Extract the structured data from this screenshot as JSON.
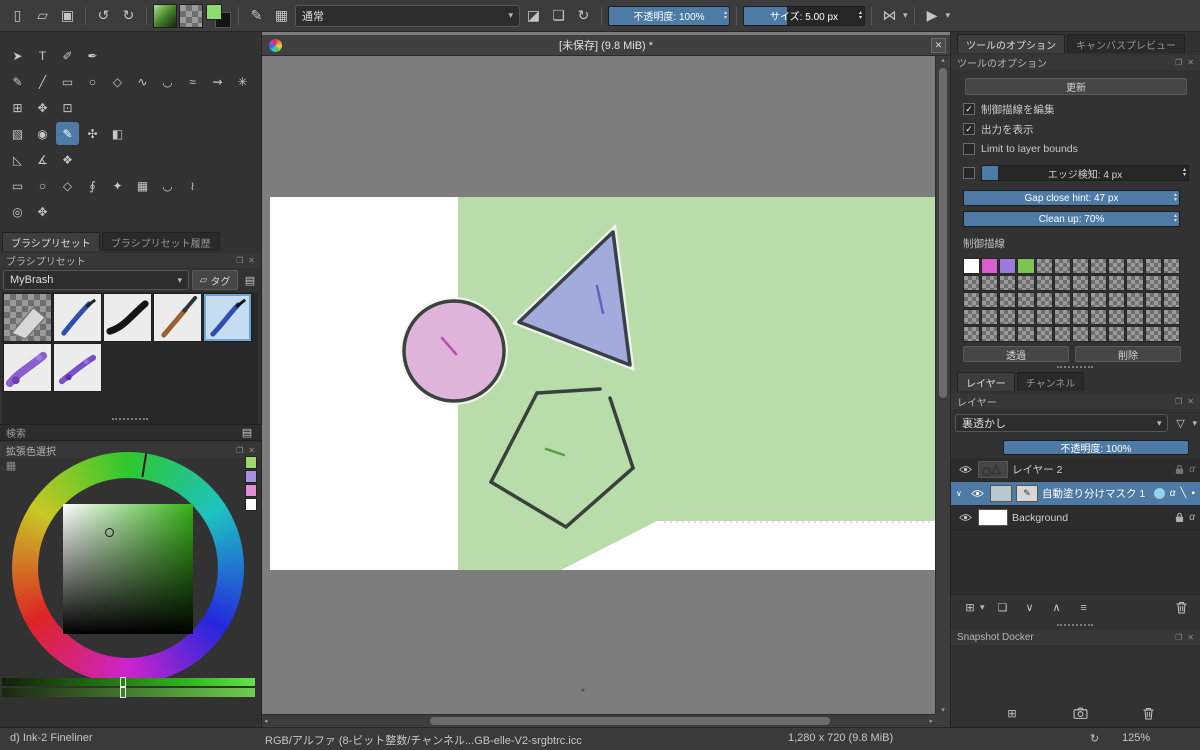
{
  "colors": {
    "accent": "#4d7ba5",
    "canvas_green": "#b9dcab",
    "shape_pink": "#dfb4da",
    "shape_blue": "#a2abdb",
    "outline": "#39423a"
  },
  "icons": {
    "check": "✓",
    "caret": "▾",
    "up": "▴",
    "down": "▾",
    "left": "◂",
    "right": "▸",
    "close": "✕",
    "float": "❐",
    "new_document": "▯",
    "open_folder": "▱",
    "save": "▣",
    "undo": "↺",
    "redo": "↻",
    "brush_preset": "✎",
    "workspaces": "▦",
    "eraser": "◪",
    "duplicate_doc": "❏",
    "reload": "↻",
    "mirror": "⋈",
    "wrap_around": "▶",
    "tag": "▱",
    "presets_menu": "▤",
    "funnel": "▽",
    "add_layer": "⊞",
    "duplicate_layer": "❏",
    "move_down": "∨",
    "move_up": "∧",
    "properties": "≡",
    "alpha": "α",
    "slash": "╲",
    "expand": "∨",
    "msquare": "▪"
  },
  "topbar": {
    "blend_mode": "通常",
    "opacity": "不透明度: 100%",
    "size": "サイズ: 5.00 px"
  },
  "toolbox": {
    "rows": [
      [
        {
          "name": "select-shapes",
          "glyph": "➤"
        },
        {
          "name": "text",
          "glyph": "T"
        },
        {
          "name": "edit-shapes",
          "glyph": "✐"
        },
        {
          "name": "calligraphy",
          "glyph": "✒"
        }
      ],
      [
        {
          "name": "freehand-brush",
          "glyph": "✎"
        },
        {
          "name": "line",
          "glyph": "╱"
        },
        {
          "name": "rectangle",
          "glyph": "▭"
        },
        {
          "name": "ellipse",
          "glyph": "○"
        },
        {
          "name": "polygon",
          "glyph": "◇"
        },
        {
          "name": "polyline",
          "glyph": "∿"
        },
        {
          "name": "bezier-curve",
          "glyph": "◡"
        },
        {
          "name": "freehand-path",
          "glyph": "≈"
        },
        {
          "name": "dynamic-brush",
          "glyph": "⇝"
        },
        {
          "name": "multibrush",
          "glyph": "✳"
        }
      ],
      [
        {
          "name": "transform",
          "glyph": "⊞"
        },
        {
          "name": "move",
          "glyph": "✥"
        },
        {
          "name": "crop",
          "glyph": "⊡"
        }
      ],
      [
        {
          "name": "gradient",
          "glyph": "▧"
        },
        {
          "name": "color-sampler",
          "glyph": "◉"
        },
        {
          "name": "colorize-mask",
          "glyph": "✎",
          "selected": true
        },
        {
          "name": "smart-patch",
          "glyph": "✣"
        },
        {
          "name": "fill",
          "glyph": "◧"
        }
      ],
      [
        {
          "name": "assistants",
          "glyph": "◺"
        },
        {
          "name": "measure",
          "glyph": "∡"
        },
        {
          "name": "reference-images",
          "glyph": "❖"
        }
      ],
      [
        {
          "name": "rect-select",
          "glyph": "▭"
        },
        {
          "name": "ellipse-select",
          "glyph": "○"
        },
        {
          "name": "polygon-select",
          "glyph": "◇"
        },
        {
          "name": "freehand-select",
          "glyph": "∮"
        },
        {
          "name": "magic-wand-select",
          "glyph": "✦"
        },
        {
          "name": "similar-color-select",
          "glyph": "▦"
        },
        {
          "name": "bezier-select",
          "glyph": "◡"
        },
        {
          "name": "magnetic-select",
          "glyph": "≀"
        }
      ],
      [
        {
          "name": "zoom",
          "glyph": "◎"
        },
        {
          "name": "pan",
          "glyph": "✥"
        }
      ]
    ]
  },
  "brushes": {
    "tabs": [
      "ブラシプリセット",
      "ブラシプリセット履歴"
    ],
    "header": "ブラシプリセット",
    "preset_group": "MyBrash",
    "tag_label": "タグ",
    "search_label": "検索"
  },
  "color_selector": {
    "header": "拡張色選択",
    "swatches": [
      "#9ed66b",
      "#a98fe0",
      "#df8fd8",
      "#ffffff"
    ]
  },
  "canvas": {
    "title": "[未保存] (9.8 MiB) *"
  },
  "tool_options": {
    "tabs": [
      "ツールのオプション",
      "キャンバスプレビュー"
    ],
    "header": "ツールのオプション",
    "update_button": "更新",
    "checkboxes": [
      {
        "label": "制御描線を編集",
        "checked": true
      },
      {
        "label": "出力を表示",
        "checked": true
      },
      {
        "label": "Limit to layer bounds",
        "checked": false
      }
    ],
    "edge_slider": "エッジ検知: 4 px",
    "gap_slider": "Gap close hint: 47 px",
    "cleanup_slider": "Clean up: 70%",
    "key_strokes_label": "制御描線",
    "key_colors": [
      "#ffffff",
      "#d95fd0",
      "#9b7ade",
      "#7bc653"
    ],
    "transparent_button": "透過",
    "remove_button": "削除"
  },
  "layers": {
    "tabs": [
      "レイヤー",
      "チャンネル"
    ],
    "header": "レイヤー",
    "blend_mode": "裏透かし",
    "opacity": "不透明度: 100%",
    "items": [
      {
        "name": "レイヤー 2"
      },
      {
        "name": "自動塗り分けマスク 1",
        "selected": true
      },
      {
        "name": "Background"
      }
    ]
  },
  "snapshot": {
    "header": "Snapshot Docker"
  },
  "statusbar": {
    "preset": "d) Ink-2 Fineliner",
    "profile": "RGB/アルファ (8-ビット整数/チャンネル...GB-elle-V2-srgbtrc.icc",
    "doc_size": "1,280 x 720 (9.8 MiB)",
    "zoom": "125%"
  }
}
